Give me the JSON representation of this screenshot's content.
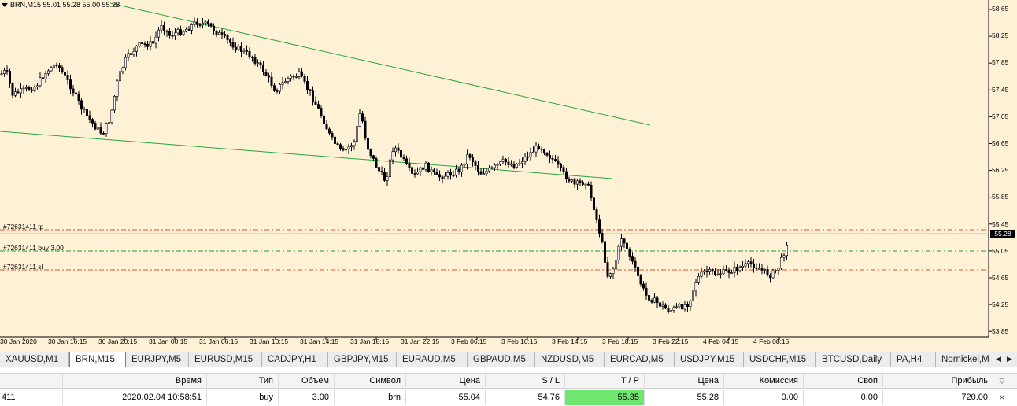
{
  "chart": {
    "info_line": "BRN,M15  55.01 55.28 55.00 55.28",
    "price_labels": [
      "58.65",
      "58.25",
      "57.85",
      "57.45",
      "57.05",
      "56.65",
      "56.25",
      "55.85",
      "55.45",
      "55.05",
      "54.65",
      "54.25",
      "53.85"
    ],
    "current_price": "55.28",
    "time_labels": [
      "30 Jan 2020",
      "30 Jan 16:15",
      "30 Jan 20:15",
      "31 Jan 00:15",
      "31 Jan 06:15",
      "31 Jan 10:15",
      "31 Jan 14:15",
      "31 Jan 18:15",
      "31 Jan 22:15",
      "3 Feb 06:15",
      "3 Feb 10:15",
      "3 Feb 14:15",
      "3 Feb 18:15",
      "3 Feb 22:15",
      "4 Feb 04:15",
      "4 Feb 08:15"
    ],
    "order_lines": {
      "tp_label": "#72631411 tp",
      "buy_label": "#72631411 buy 3.00",
      "sl_label": "#72631411 sl"
    },
    "colors": {
      "background": "#fff1d6",
      "candle": "#000000",
      "trendline": "#22a83a",
      "tp_sl_line": "#e2522b",
      "buy_line": "#1f9a2c",
      "tp_cell": "#6fe66f"
    }
  },
  "tabs": [
    "XAUUSD,M1",
    "BRN,M15",
    "EURJPY,M5",
    "EURUSD,M15",
    "CADJPY,H1",
    "GBPJPY,M15",
    "EURAUD,M5",
    "GBPAUD,M5",
    "NZDUSD,M5",
    "EURCAD,M5",
    "USDJPY,M15",
    "USDCHF,M15",
    "BTCUSD,Daily",
    "PA,H4",
    "Nornickel,M"
  ],
  "active_tab": "BRN,M15",
  "terminal": {
    "headers": [
      "",
      "Время",
      "Тип",
      "Объем",
      "Символ",
      "Цена",
      "S / L",
      "T / P",
      "Цена",
      "Комиссия",
      "Своп",
      "Прибыль"
    ],
    "row": [
      "411",
      "2020.02.04 10:58:51",
      "buy",
      "3.00",
      "brn",
      "55.04",
      "54.76",
      "55.35",
      "55.28",
      "0.00",
      "0.00",
      "720.00"
    ]
  }
}
